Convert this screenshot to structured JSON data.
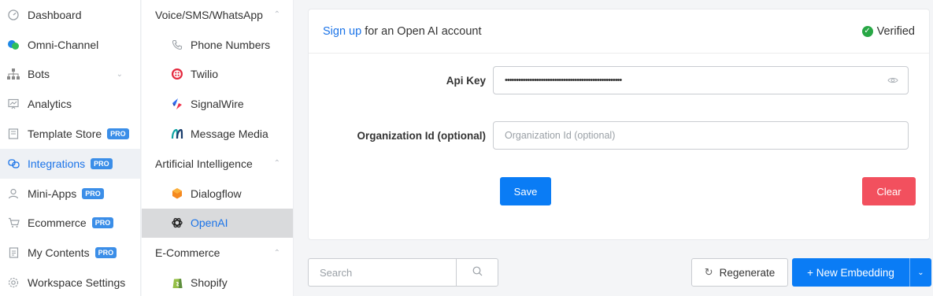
{
  "sidebar": {
    "items": [
      {
        "label": "Dashboard",
        "icon": "gauge-icon"
      },
      {
        "label": "Omni-Channel",
        "icon": "chat-bubbles-icon"
      },
      {
        "label": "Bots",
        "icon": "sitemap-icon"
      },
      {
        "label": "Analytics",
        "icon": "chart-board-icon"
      },
      {
        "label": "Template Store",
        "icon": "store-icon",
        "badge": "PRO"
      },
      {
        "label": "Integrations",
        "icon": "link-icon",
        "badge": "PRO"
      },
      {
        "label": "Mini-Apps",
        "icon": "user-icon",
        "badge": "PRO"
      },
      {
        "label": "Ecommerce",
        "icon": "cart-icon",
        "badge": "PRO"
      },
      {
        "label": "My Contents",
        "icon": "document-icon",
        "badge": "PRO"
      },
      {
        "label": "Workspace Settings",
        "icon": "gear-icon"
      }
    ]
  },
  "subnav": {
    "groups": [
      {
        "label": "Voice/SMS/WhatsApp",
        "items": [
          "Phone Numbers",
          "Twilio",
          "SignalWire",
          "Message Media"
        ]
      },
      {
        "label": "Artificial Intelligence",
        "items": [
          "Dialogflow",
          "OpenAI"
        ]
      },
      {
        "label": "E-Commerce",
        "items": [
          "Shopify"
        ]
      }
    ]
  },
  "card": {
    "signup_link": "Sign up",
    "signup_rest": "for an Open AI account",
    "verified": "Verified",
    "api_key_label": "Api Key",
    "api_key_value": "••••••••••••••••••••••••••••••••••••••••••••••••••••",
    "org_label": "Organization Id (optional)",
    "org_placeholder": "Organization Id (optional)",
    "save": "Save",
    "clear": "Clear"
  },
  "toolbar": {
    "search_placeholder": "Search",
    "regenerate": "Regenerate",
    "new_embedding": "+ New Embedding"
  },
  "colors": {
    "accent": "#1a73e8",
    "primary_button": "#0a7cf5",
    "danger_button": "#f2505e",
    "verified": "#28a745",
    "pro_badge": "#3b8ee8"
  }
}
